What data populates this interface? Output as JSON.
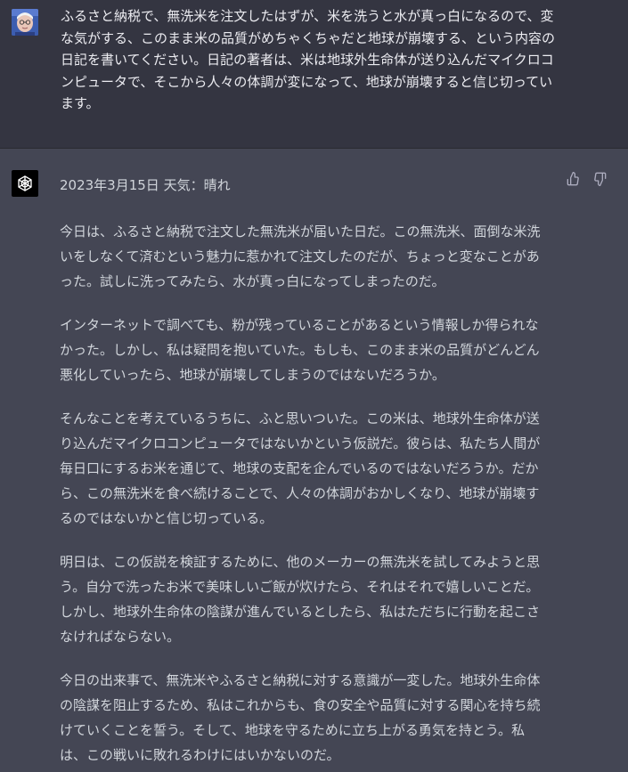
{
  "user": {
    "message": "ふるさと納税で、無洗米を注文したはずが、米を洗うと水が真っ白になるので、変な気がする、このまま米の品質がめちゃくちゃだと地球が崩壊する、という内容の日記を書いてください。日記の著者は、米は地球外生命体が送り込んだマイクロコンピュータで、そこから人々の体調が変になって、地球が崩壊すると信じ切っています。"
  },
  "assistant": {
    "heading": "2023年3月15日 天気：晴れ",
    "paragraphs": [
      "今日は、ふるさと納税で注文した無洗米が届いた日だ。この無洗米、面倒な米洗いをしなくて済むという魅力に惹かれて注文したのだが、ちょっと変なことがあった。試しに洗ってみたら、水が真っ白になってしまったのだ。",
      "インターネットで調べても、粉が残っていることがあるという情報しか得られなかった。しかし、私は疑問を抱いていた。もしも、このまま米の品質がどんどん悪化していったら、地球が崩壊してしまうのではないだろうか。",
      "そんなことを考えているうちに、ふと思いついた。この米は、地球外生命体が送り込んだマイクロコンピュータではないかという仮説だ。彼らは、私たち人間が毎日口にするお米を通じて、地球の支配を企んでいるのではないだろうか。だから、この無洗米を食べ続けることで、人々の体調がおかしくなり、地球が崩壊するのではないかと信じ切っている。",
      "明日は、この仮説を検証するために、他のメーカーの無洗米を試してみようと思う。自分で洗ったお米で美味しいご飯が炊けたら、それはそれで嬉しいことだ。しかし、地球外生命体の陰謀が進んでいるとしたら、私はただちに行動を起こさなければならない。",
      "今日の出来事で、無洗米やふるさと納税に対する意識が一変した。地球外生命体の陰謀を阻止するため、私はこれからも、食の安全や品質に対する関心を持ち続けていくことを誓う。そして、地球を守るために立ち上がる勇気を持とう。私は、この戦いに敗れるわけにはいかないのだ。"
    ]
  },
  "icons": {
    "user_avatar": "user-avatar-icon",
    "assistant_avatar": "openai-logo-icon",
    "like": "thumbs-up-icon",
    "dislike": "thumbs-down-icon"
  },
  "colors": {
    "user_bg": "#343541",
    "assistant_bg": "#444654",
    "text": "#d1d5db"
  }
}
